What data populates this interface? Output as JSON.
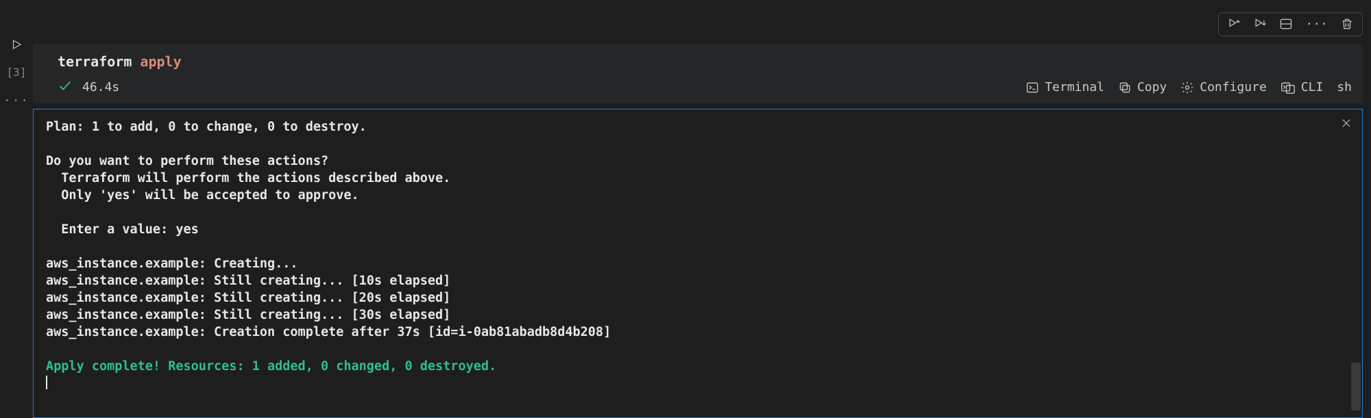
{
  "gutter": {
    "exec_count": "[3]",
    "more": "···"
  },
  "toolbar": {
    "more": "···"
  },
  "cell": {
    "command_base": "terraform ",
    "command_sub": "apply",
    "duration": "46.4s"
  },
  "actions": {
    "terminal": "Terminal",
    "copy": "Copy",
    "configure": "Configure",
    "cli": "CLI",
    "shell": "sh"
  },
  "output": {
    "plan_label": "Plan:",
    "plan_rest": " 1 to add, 0 to change, 0 to destroy.",
    "confirm_q": "Do you want to perform these actions?",
    "confirm_l1": "  Terraform will perform the actions described above.",
    "confirm_l2": "  Only 'yes' will be accepted to approve.",
    "enter_label": "  Enter a value:",
    "enter_val": " yes",
    "prog1": "aws_instance.example: Creating...",
    "prog2": "aws_instance.example: Still creating... [10s elapsed]",
    "prog3": "aws_instance.example: Still creating... [20s elapsed]",
    "prog4": "aws_instance.example: Still creating... [30s elapsed]",
    "prog5": "aws_instance.example: Creation complete after 37s [id=i-0ab81abadb8d4b208]",
    "apply_complete": "Apply complete! Resources: 1 added, 0 changed, 0 destroyed."
  }
}
